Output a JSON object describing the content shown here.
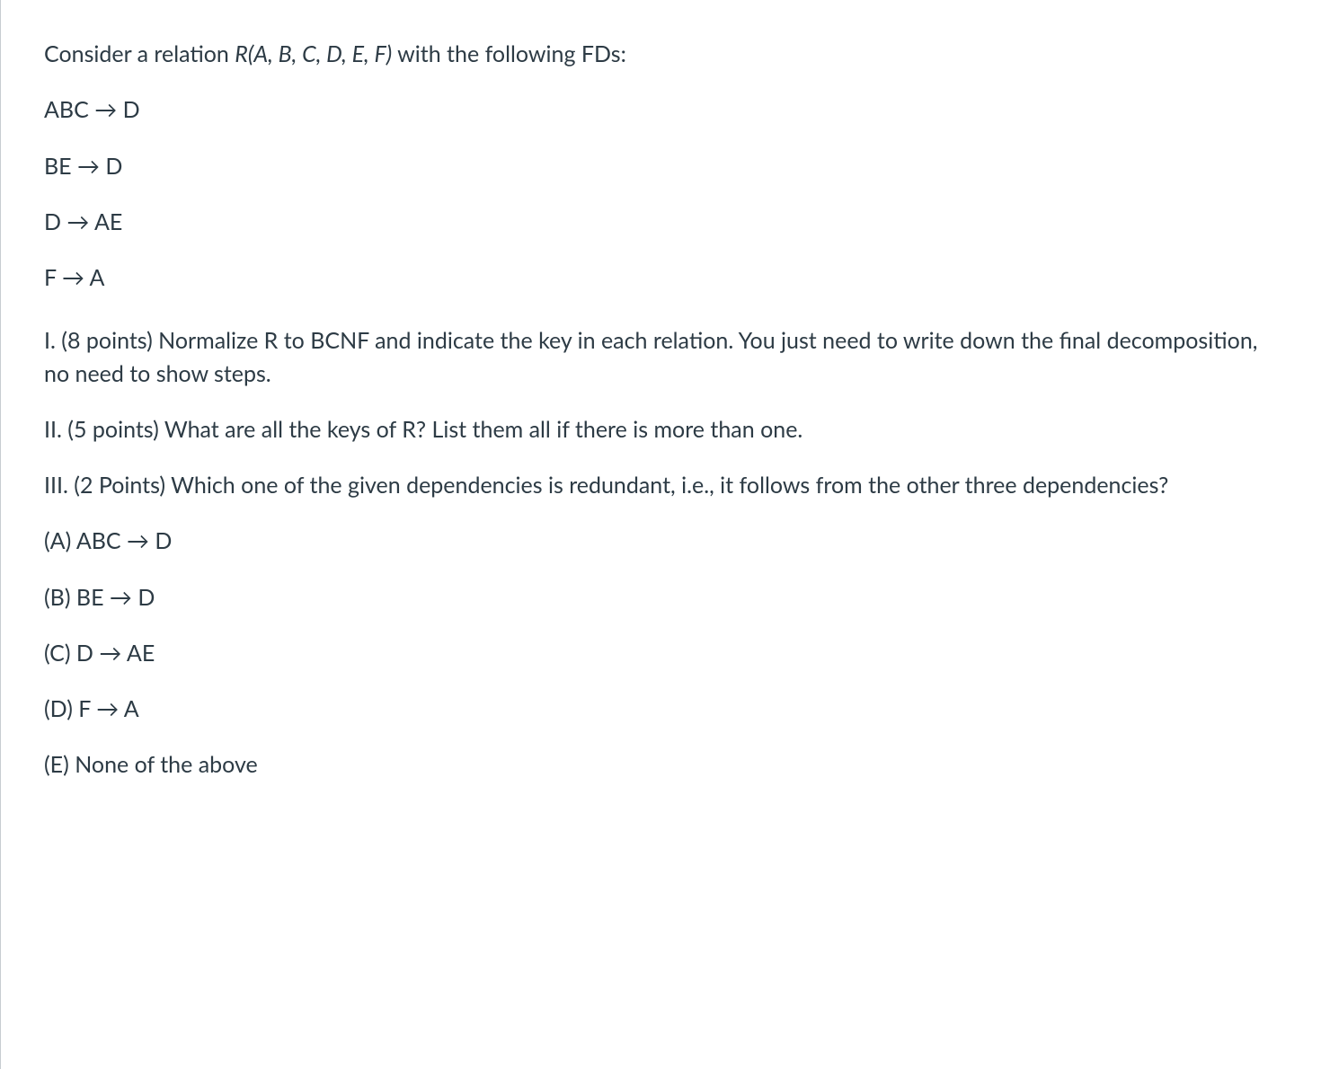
{
  "intro_prefix": "Consider a relation ",
  "relation": "R(A, B, C, D, E, F)",
  "intro_suffix": " with the following FDs:",
  "fds": [
    "ABC → D",
    "BE → D",
    "D → AE",
    "F → A"
  ],
  "q1": "I.  (8 points) Normalize R to BCNF and indicate the key in each relation. You just need to write down the final decomposition, no need to show steps.",
  "q2": "II.  (5 points) What are all the keys of R? List them all if there is more than one.",
  "q3": "III. (2 Points) Which one of the given dependencies is redundant, i.e., it follows from the other three dependencies?",
  "options": [
    "(A)  ABC → D",
    "(B)  BE → D",
    "(C)  D → AE",
    "(D) F → A",
    "(E)  None of the above"
  ]
}
